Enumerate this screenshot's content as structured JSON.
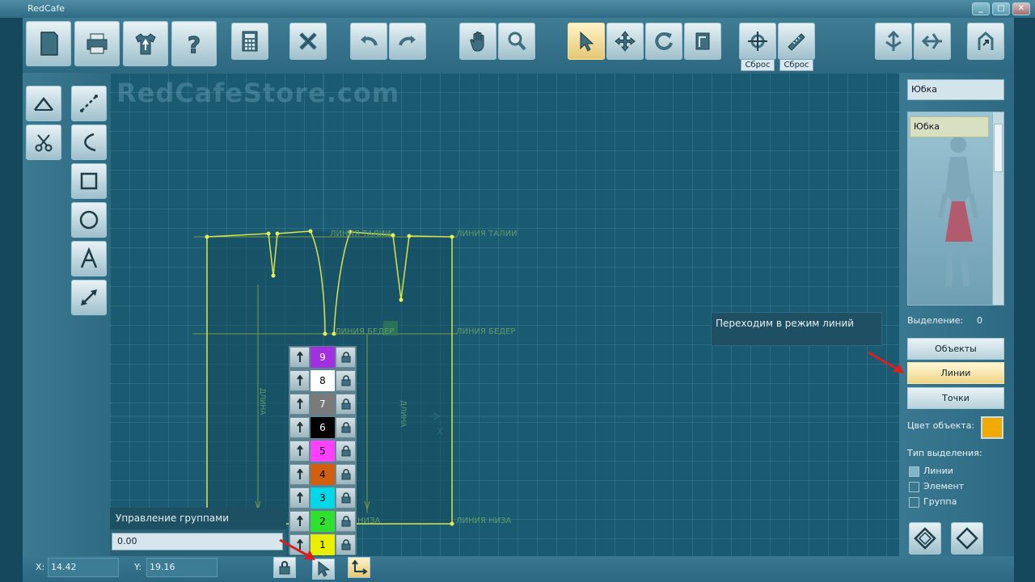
{
  "window": {
    "title": "RedCafe",
    "min_glyph": "_",
    "max_glyph": "□",
    "close_glyph": "✕"
  },
  "toolbar": {
    "reset_label_1": "Сброс",
    "reset_label_2": "Сброс"
  },
  "canvas": {
    "watermark": "RedCafeStore.com",
    "labels": {
      "waist_right": "ЛИНИЯ ТАЛИИ",
      "waist_mid": "ЛИНИЯ ТАЛИИ",
      "hip_right": "ЛИНИЯ БЕДЕР",
      "hip_mid": "ЛИНИЯ БЕДЕР",
      "hem_right": "ЛИНИЯ НИЗА",
      "hem_mid": "НИЗА",
      "vert_left": "ДЛИНА",
      "vert_right": "ДЛИНА",
      "axis_x": "X"
    }
  },
  "tooltip": {
    "text": "Переходим в режим линий"
  },
  "layers": [
    {
      "num": "9",
      "color": "#a030e0",
      "text_color": "#ffffff"
    },
    {
      "num": "8",
      "color": "#ffffff",
      "text_color": "#000000"
    },
    {
      "num": "7",
      "color": "#7a7a7a",
      "text_color": "#ffffff"
    },
    {
      "num": "6",
      "color": "#000000",
      "text_color": "#ffffff"
    },
    {
      "num": "5",
      "color": "#ff40ff",
      "text_color": "#000000"
    },
    {
      "num": "4",
      "color": "#d06010",
      "text_color": "#000000"
    },
    {
      "num": "3",
      "color": "#00d8e8",
      "text_color": "#000000"
    },
    {
      "num": "2",
      "color": "#30e030",
      "text_color": "#000000"
    },
    {
      "num": "1",
      "color": "#e8f000",
      "text_color": "#000000"
    }
  ],
  "group_control": {
    "title": "Управление группами",
    "value": "0.00"
  },
  "right_panel": {
    "object_name": "Юбка",
    "list_item": "Юбка",
    "selection_label": "Выделение:",
    "selection_count": "0",
    "btn_objects": "Объекты",
    "btn_lines": "Линии",
    "btn_points": "Точки",
    "object_color_label": "Цвет объекта:",
    "object_color": "#f2a900",
    "selection_type_label": "Тип выделения:",
    "opt_lines": "Линии",
    "opt_element": "Элемент",
    "opt_group": "Группа"
  },
  "status": {
    "x_label": "X:",
    "x_value": "14.42",
    "y_label": "Y:",
    "y_value": "19.16"
  }
}
